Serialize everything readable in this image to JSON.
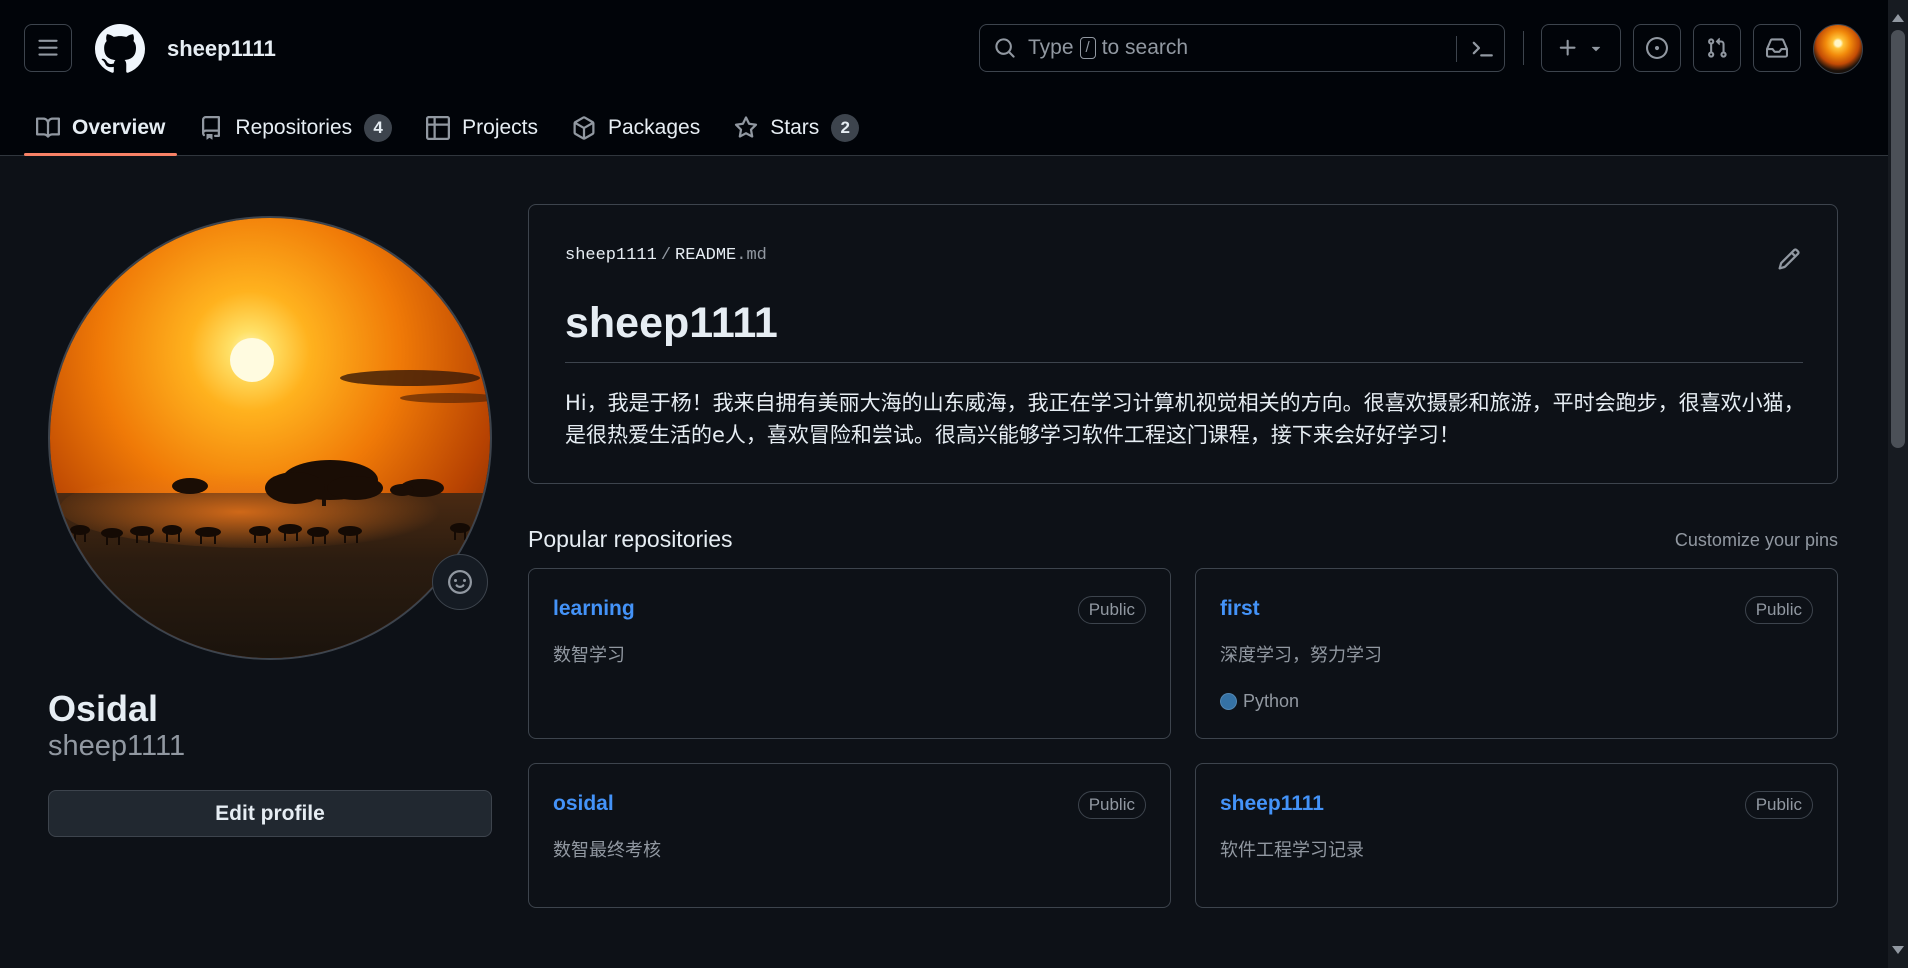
{
  "header": {
    "username": "sheep1111",
    "search": {
      "text_before": "Type",
      "key": "/",
      "text_after": "to search"
    }
  },
  "tabs": [
    {
      "label": "Overview",
      "icon": "book-icon",
      "active": true
    },
    {
      "label": "Repositories",
      "icon": "repo-icon",
      "count": "4"
    },
    {
      "label": "Projects",
      "icon": "table-icon"
    },
    {
      "label": "Packages",
      "icon": "package-icon"
    },
    {
      "label": "Stars",
      "icon": "star-icon",
      "count": "2"
    }
  ],
  "profile": {
    "display_name": "Osidal",
    "login": "sheep1111",
    "edit_label": "Edit profile"
  },
  "readme": {
    "owner": "sheep1111",
    "separator": "/",
    "file_base": "README",
    "file_ext": ".md",
    "title": "sheep1111",
    "body": "Hi，我是于杨！我来自拥有美丽大海的山东威海，我正在学习计算机视觉相关的方向。很喜欢摄影和旅游，平时会跑步，很喜欢小猫，是很热爱生活的e人，喜欢冒险和尝试。很高兴能够学习软件工程这门课程，接下来会好好学习！"
  },
  "popular": {
    "title": "Popular repositories",
    "customize": "Customize your pins",
    "repos": [
      {
        "name": "learning",
        "visibility": "Public",
        "description": "数智学习"
      },
      {
        "name": "first",
        "visibility": "Public",
        "description": "深度学习，努力学习",
        "language": "Python",
        "language_color": "#3572A5"
      },
      {
        "name": "osidal",
        "visibility": "Public",
        "description": "数智最终考核"
      },
      {
        "name": "sheep1111",
        "visibility": "Public",
        "description": "软件工程学习记录"
      }
    ]
  },
  "colors": {
    "accent_link": "#4493f8",
    "active_tab_underline": "#f78166",
    "background": "#0d1117"
  }
}
